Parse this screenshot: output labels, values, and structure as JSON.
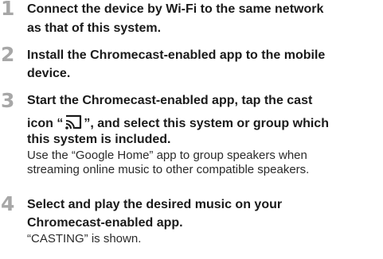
{
  "steps": [
    {
      "number": "1",
      "lines": [
        "Connect the device by Wi-Fi to the same network",
        "as that of this system."
      ]
    },
    {
      "number": "2",
      "lines": [
        "Install the Chromecast-enabled app to the mobile",
        "device."
      ]
    },
    {
      "number": "3",
      "line1": "Start the Chromecast-enabled app, tap the cast",
      "line2_before_icon": "icon “",
      "line2_icon": "cast-icon",
      "line2_after_icon": "”, and select this system or group which",
      "line3": "this system is included.",
      "notes": [
        "Use the “Google Home” app to group speakers when",
        "streaming online music to other compatible speakers."
      ]
    },
    {
      "number": "4",
      "lines": [
        "Select and play the desired music on your",
        "Chromecast-enabled app."
      ],
      "notes": [
        "“CASTING” is shown."
      ]
    }
  ]
}
